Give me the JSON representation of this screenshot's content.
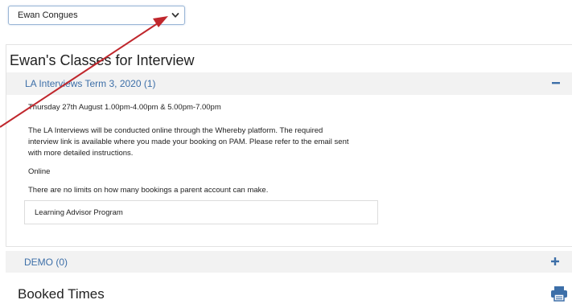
{
  "selector": {
    "value": "Ewan Congues"
  },
  "classes_card": {
    "title": "Ewan's Classes for Interview",
    "accordion_1": {
      "label": "LA Interviews Term 3, 2020 (1)",
      "state": "expanded",
      "date_line": "Thursday 27th August 1.00pm-4.00pm & 5.00pm-7.00pm",
      "description_lines": [
        "The LA Interviews will be conducted online through the Whereby platform. The required",
        "interview link is available where you made your booking on PAM. Please refer to the email sent",
        "with more detailed instructions."
      ],
      "location": "Online",
      "booking_limit": "There are no limits on how many bookings a parent account can make.",
      "program": "Learning Advisor Program"
    }
  },
  "accordion_2": {
    "label": "DEMO (0)",
    "state": "collapsed"
  },
  "booked_times": {
    "heading": "Booked Times",
    "print_icon": "printer-icon"
  },
  "colors": {
    "accent_blue": "#3d6fa8",
    "annotation_arrow": "#c0272d",
    "header_bg": "#f2f2f2"
  }
}
